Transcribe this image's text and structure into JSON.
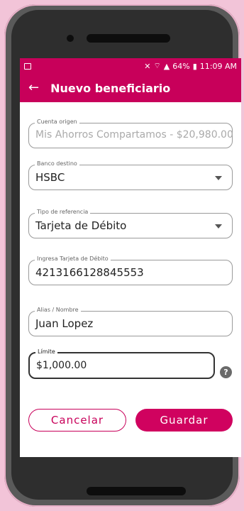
{
  "status_bar": {
    "battery": "64%",
    "time": "11:09 AM"
  },
  "app_bar": {
    "back_icon": "arrow-left-icon",
    "title": "Nuevo beneficiario"
  },
  "form": {
    "cuenta_origen": {
      "label": "Cuenta origen",
      "value": "Mis Ahorros Compartamos - $20,980.00"
    },
    "banco_destino": {
      "label": "Banco destino",
      "value": "HSBC"
    },
    "tipo_referencia": {
      "label": "Tipo de referencia",
      "value": "Tarjeta de Débito"
    },
    "tarjeta": {
      "label": "Ingresa Tarjeta de Débito",
      "value": "4213166128845553"
    },
    "alias": {
      "label": "Alias / Nombre",
      "value": "Juan Lopez"
    },
    "limite": {
      "label": "Límite",
      "value": "$1,000.00"
    }
  },
  "actions": {
    "cancel_label": "Cancelar",
    "save_label": "Guardar"
  },
  "colors": {
    "brand": "#c8005a",
    "background": "#f2c4d8"
  }
}
